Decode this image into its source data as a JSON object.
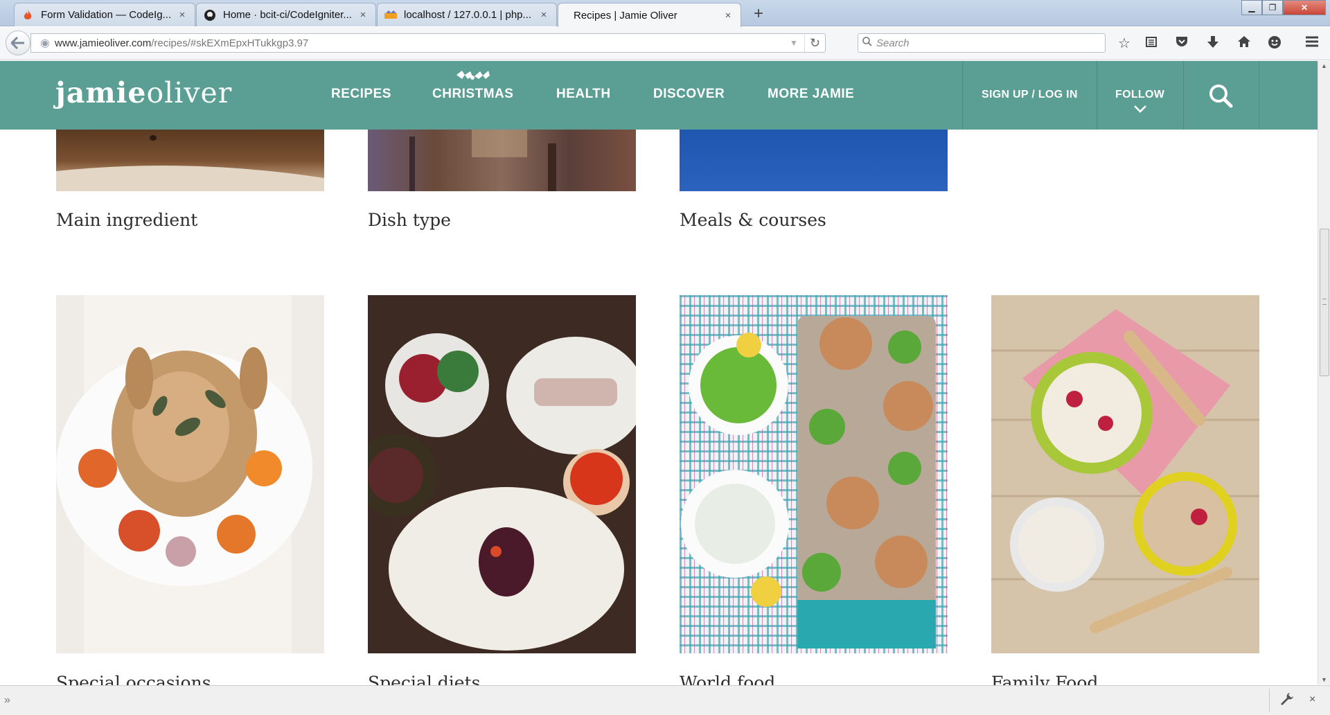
{
  "browser": {
    "tabs": [
      {
        "label": "Form Validation — CodeIg...",
        "icon": "flame-icon",
        "active": false
      },
      {
        "label": "Home · bcit-ci/CodeIgniter...",
        "icon": "github-icon",
        "active": false
      },
      {
        "label": "localhost / 127.0.0.1 | php...",
        "icon": "phpmyadmin-icon",
        "active": false
      },
      {
        "label": "Recipes | Jamie Oliver",
        "icon": "",
        "active": true
      }
    ],
    "url_host": "www.jamieoliver.com",
    "url_path": "/recipes/#skEXmEpxHTukkgp3.97",
    "search_placeholder": "Search",
    "toolbar_icons": [
      "bookmark-star-icon",
      "reading-list-icon",
      "pocket-icon",
      "download-icon",
      "home-icon",
      "social-icon",
      "menu-icon"
    ]
  },
  "site": {
    "logo_bold": "jamie",
    "logo_light": "oliver",
    "nav": [
      "RECIPES",
      "CHRISTMAS",
      "HEALTH",
      "DISCOVER",
      "MORE JAMIE"
    ],
    "signup": "SIGN UP / LOG IN",
    "follow": "FOLLOW",
    "header_color": "#5a9e94"
  },
  "categories_top": [
    "Main ingredient",
    "Dish type",
    "Meals & courses"
  ],
  "categories_bottom": [
    "Special occasions",
    "Special diets",
    "World food",
    "Family Food"
  ]
}
